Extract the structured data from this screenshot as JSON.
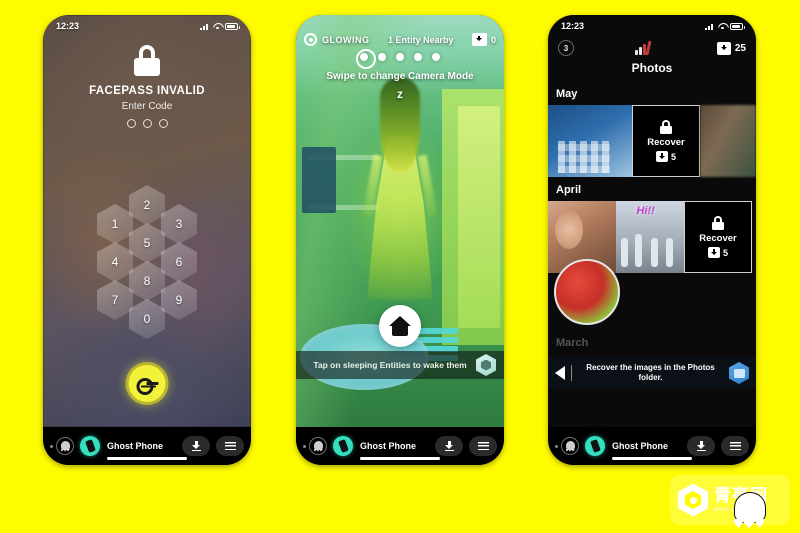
{
  "background_color": "#FFFC00",
  "phones": {
    "lock": {
      "status": {
        "time": "12:23",
        "icons": [
          "signal-icon",
          "wifi-icon",
          "battery-icon"
        ]
      },
      "lock_icon": "lock-icon",
      "title": "FACEPASS INVALID",
      "subtitle": "Enter Code",
      "code_dots": 3,
      "keypad": [
        "2",
        "1",
        "3",
        "5",
        "4",
        "6",
        "8",
        "7",
        "9",
        "0"
      ],
      "key_button": "key-icon",
      "bar": {
        "app_name": "Ghost Phone",
        "download": "download-icon",
        "menu": "menu-icon"
      }
    },
    "camera": {
      "mode_label": "GLOWING",
      "entity_label": "1 Entity Nearby",
      "capture_count": "0",
      "mode_dots": 5,
      "active_dot": 1,
      "swipe_hint": "Swipe to change Camera Mode",
      "sleep_mark": "z",
      "home_button": "home-icon",
      "tip": "Tap on sleeping Entities to wake them",
      "tip_badge": "hex-badge-icon",
      "bar": {
        "app_name": "Ghost Phone",
        "download": "download-icon",
        "menu": "menu-icon"
      }
    },
    "photos": {
      "status": {
        "time": "12:23",
        "icons": [
          "signal-icon",
          "wifi-icon",
          "battery-icon"
        ]
      },
      "header": {
        "badge_count": "3",
        "center_icon": "signal-bars-icon",
        "download_count": "25"
      },
      "title": "Photos",
      "sections": [
        {
          "month": "May",
          "tiles": [
            {
              "type": "photo",
              "name": "bedroom-photo"
            },
            {
              "type": "recover",
              "label": "Recover",
              "count": "5",
              "lock": "lock-icon"
            },
            {
              "type": "photo",
              "name": "blurred-photo"
            }
          ]
        },
        {
          "month": "April",
          "tiles": [
            {
              "type": "photo",
              "name": "selfie-photo"
            },
            {
              "type": "photo",
              "name": "dancing-photo",
              "overlay_text": "Hi!!"
            },
            {
              "type": "recover",
              "label": "Recover",
              "count": "5",
              "lock": "lock-icon"
            },
            {
              "type": "photo",
              "name": "fruit-bowl-photo"
            }
          ]
        },
        {
          "month": "March",
          "tiles": []
        }
      ],
      "toast": {
        "back": "back-arrow-icon",
        "message": "Recover the images in the Photos folder.",
        "badge": "hex-badge-icon"
      },
      "bar": {
        "app_name": "Ghost Phone",
        "download": "download-icon",
        "menu": "menu-icon"
      }
    }
  },
  "watermark": {
    "name": "青亭网",
    "url": "www.7tin.cn",
    "logo": "hex-logo-icon",
    "ghost": "ghost-icon"
  }
}
